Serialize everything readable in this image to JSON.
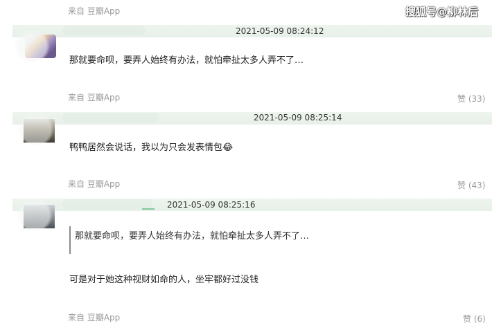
{
  "watermark": "搜狐号@柳林后",
  "comments": [
    {
      "source": "来自 豆瓣App",
      "timestamp": "2021-05-09 08:24:12",
      "text": "那就要命呗，要弄人始终有办法，就怕牵扯太多人弄不了…",
      "likes": "赞 (33)"
    },
    {
      "source": "来自 豆瓣App",
      "timestamp": "2021-05-09 08:25:14",
      "text": "鸭鸭居然会说话，我以为只会发表情包😂",
      "likes": "赞 (43)"
    },
    {
      "source": "来自 豆瓣App",
      "timestamp": "2021-05-09 08:25:16",
      "quote": "那就要命呗，要弄人始终有办法，就怕牵扯太多人弄不了…",
      "text": "可是对于她这种视财如命的人，坐牢都好过没钱",
      "likes": "赞 (6)"
    },
    {
      "source": "来自 豆瓣App"
    }
  ]
}
